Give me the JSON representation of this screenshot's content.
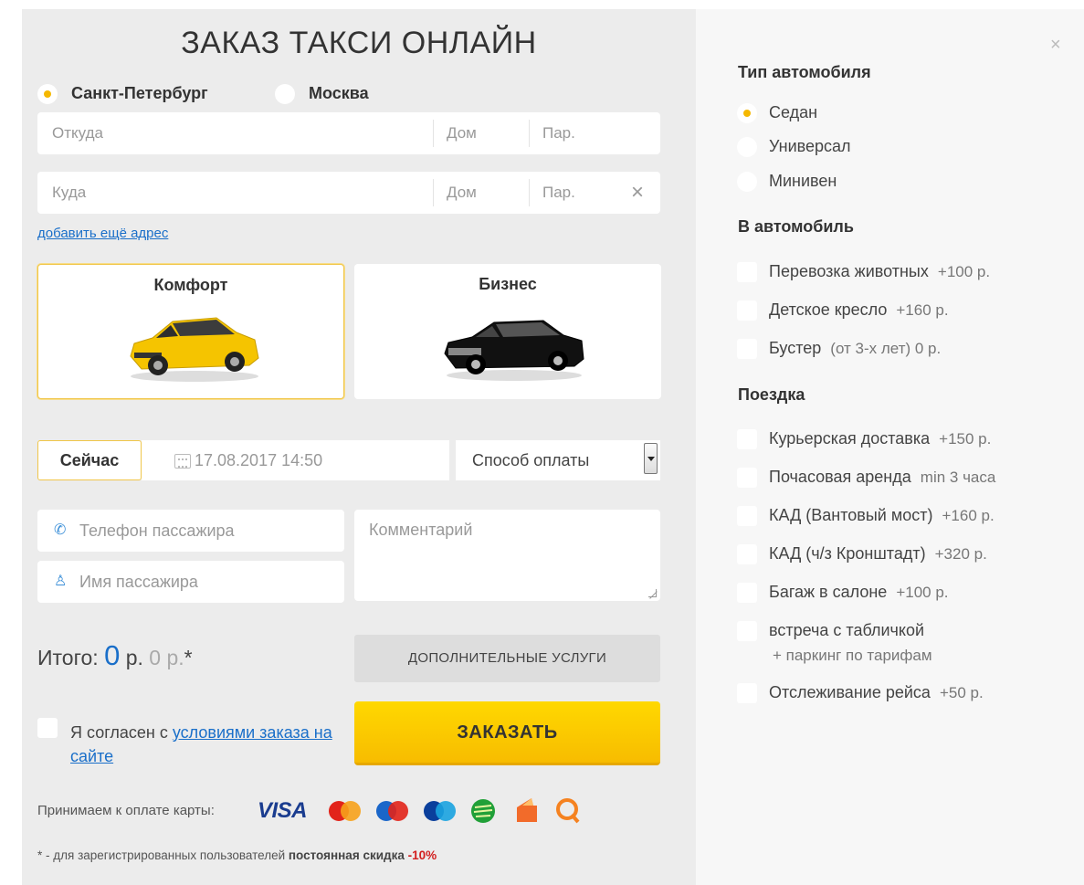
{
  "form": {
    "title": "ЗАКАЗ ТАКСИ ОНЛАЙН",
    "cities": [
      {
        "label": "Санкт-Петербург",
        "selected": true
      },
      {
        "label": "Москва",
        "selected": false
      }
    ],
    "from": {
      "placeholder": "Откуда",
      "house": "Дом",
      "entrance": "Пар."
    },
    "to": {
      "placeholder": "Куда",
      "house": "Дом",
      "entrance": "Пар."
    },
    "add_address": "добавить ещё адрес",
    "tariffs": [
      {
        "label": "Комфорт",
        "selected": true,
        "car_color": "#f5c400"
      },
      {
        "label": "Бизнес",
        "selected": false,
        "car_color": "#111111"
      }
    ],
    "now_label": "Сейчас",
    "datetime": "17.08.2017 14:50",
    "payment_placeholder": "Способ оплаты",
    "phone_placeholder": "Телефон пассажира",
    "name_placeholder": "Имя пассажира",
    "comment_placeholder": "Комментарий",
    "total_label": "Итого:",
    "total_value": "0",
    "total_currency": "р.",
    "total_secondary": "0 р.",
    "total_star": "*",
    "extras_button": "ДОПОЛНИТЕЛЬНЫЕ УСЛУГИ",
    "agree_prefix": "Я согласен с",
    "agree_link": "условиями заказа на сайте",
    "order_button": "ЗАКАЗАТЬ",
    "cards_label": "Принимаем к оплате карты:",
    "footnote_prefix": "* - для зарегистрированных пользователей",
    "footnote_bold": "постоянная скидка",
    "footnote_discount": "-10%"
  },
  "options": {
    "car_type_title": "Тип автомобиля",
    "car_types": [
      {
        "label": "Седан",
        "selected": true
      },
      {
        "label": "Универсал",
        "selected": false
      },
      {
        "label": "Минивен",
        "selected": false
      }
    ],
    "in_car_title": "В автомобиль",
    "in_car": [
      {
        "label": "Перевозка животных",
        "extra": "+100 р."
      },
      {
        "label": "Детское кресло",
        "extra": "+160 р."
      },
      {
        "label": "Бустер",
        "extra": "(от 3-х лет) 0 р."
      }
    ],
    "trip_title": "Поездка",
    "trip": [
      {
        "label": "Курьерская доставка",
        "extra": "+150 р."
      },
      {
        "label": "Почасовая аренда",
        "extra": "min 3 часа"
      },
      {
        "label": "КАД (Вантовый мост)",
        "extra": "+160 р."
      },
      {
        "label": "КАД (ч/з Кронштадт)",
        "extra": "+320 р."
      },
      {
        "label": "Багаж в салоне",
        "extra": "+100 р."
      },
      {
        "label": "встреча с табличкой",
        "extra": "",
        "sub": "+ паркинг по тарифам"
      },
      {
        "label": "Отслеживание рейса",
        "extra": "+50 р."
      }
    ]
  },
  "payment_icons": [
    "visa-icon",
    "mastercard-icon",
    "maestro-icon",
    "cirrus-icon",
    "sberbank-icon",
    "yandex-money-icon",
    "qiwi-icon"
  ],
  "colors": {
    "accent": "#f5b800",
    "link": "#1a6fc9",
    "discount": "#d21f1f",
    "panel_left": "#ececec",
    "panel_right": "#f7f7f7"
  }
}
